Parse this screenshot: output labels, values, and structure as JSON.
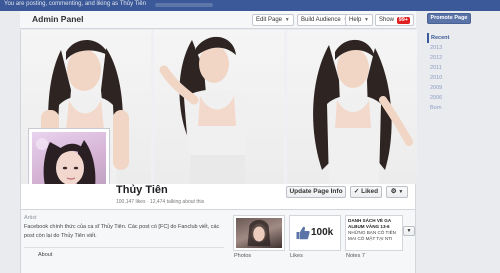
{
  "topbar": {
    "text": "You are posting, commenting, and liking as Thủy Tiên"
  },
  "admin": {
    "title": "Admin Panel",
    "edit_page": "Edit Page",
    "build_audience": "Build Audience",
    "help": "Help",
    "show": "Show",
    "notifications": "99+"
  },
  "profile": {
    "name": "Thủy Tiên",
    "stats": "100,147 likes · 12,474 talking about this"
  },
  "actions": {
    "update_info": "Update Page Info",
    "liked": "✓ Liked",
    "settings_icon": "gear-icon"
  },
  "about": {
    "label": "Artist",
    "text": "Facebook chính thức của ca sĩ Thủy Tiên. Các post có [FC] do Fanclub viết, các post còn lại do Thủy Tiên viết.",
    "footer": "About"
  },
  "tiles": {
    "photos_label": "Photos",
    "likes_label": "Likes",
    "likes_count": "100k",
    "notes_label": "Notes",
    "notes_count": "7",
    "notes_title": "DANH SÁCH VÉ GA ALBUM VÀNG 13-6",
    "notes_body": "NHỮNG BẠN CÓ TIÊN MAI CÓ MẶT TẠI NTI"
  },
  "sidebar": {
    "promote": "Promote Page",
    "timeline": [
      "Recent",
      "2013",
      "2012",
      "2011",
      "2010",
      "2009",
      "2006",
      "Born"
    ]
  },
  "colors": {
    "brand": "#3b5998",
    "badge": "#e02020"
  }
}
